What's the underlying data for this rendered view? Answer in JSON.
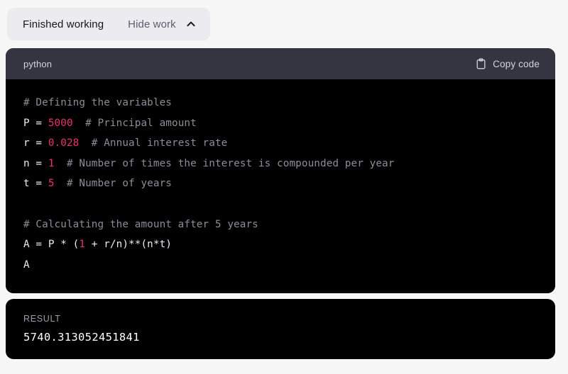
{
  "colors": {
    "page_background": "#f7f7f8",
    "pill_background": "#ebebf0",
    "code_header_background": "#343541",
    "code_background": "#000000",
    "comment": "#8b8e98",
    "number": "#e8336d",
    "code_text": "#ececf1",
    "result_label": "#9b9eab"
  },
  "status": {
    "label": "Finished working",
    "toggle_label": "Hide work",
    "toggle_icon": "chevron-up-icon"
  },
  "code_block": {
    "language": "python",
    "copy_label": "Copy code",
    "copy_icon": "clipboard-icon",
    "lines": [
      [
        {
          "t": "comment",
          "s": "# Defining the variables"
        }
      ],
      [
        {
          "t": "plain",
          "s": "P = "
        },
        {
          "t": "num",
          "s": "5000"
        },
        {
          "t": "comment",
          "s": "  # Principal amount"
        }
      ],
      [
        {
          "t": "plain",
          "s": "r = "
        },
        {
          "t": "num",
          "s": "0.028"
        },
        {
          "t": "comment",
          "s": "  # Annual interest rate"
        }
      ],
      [
        {
          "t": "plain",
          "s": "n = "
        },
        {
          "t": "num",
          "s": "1"
        },
        {
          "t": "comment",
          "s": "  # Number of times the interest is compounded per year"
        }
      ],
      [
        {
          "t": "plain",
          "s": "t = "
        },
        {
          "t": "num",
          "s": "5"
        },
        {
          "t": "comment",
          "s": "  # Number of years"
        }
      ],
      [
        {
          "t": "plain",
          "s": ""
        }
      ],
      [
        {
          "t": "comment",
          "s": "# Calculating the amount after 5 years"
        }
      ],
      [
        {
          "t": "plain",
          "s": "A = P * ("
        },
        {
          "t": "num",
          "s": "1"
        },
        {
          "t": "plain",
          "s": " + r/n)**(n*t)"
        }
      ],
      [
        {
          "t": "plain",
          "s": "A"
        }
      ]
    ]
  },
  "result": {
    "label": "RESULT",
    "value": "5740.313052451841"
  }
}
